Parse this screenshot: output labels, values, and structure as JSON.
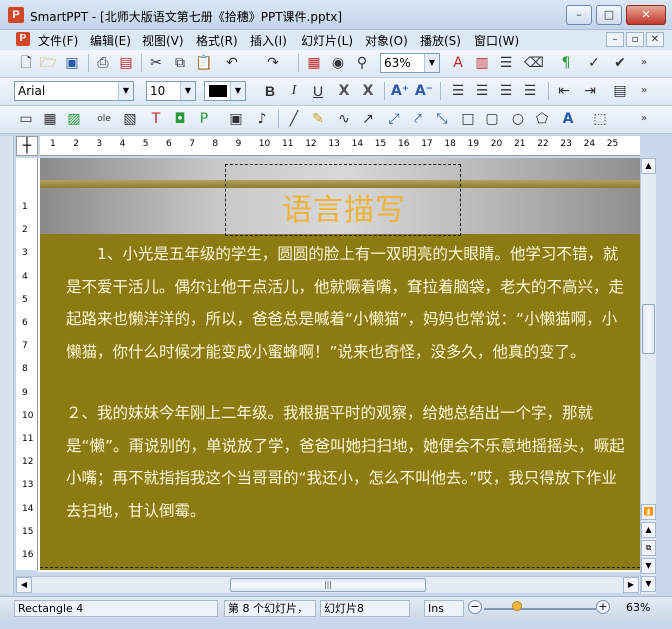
{
  "window": {
    "title": "SmartPPT - [北师大版语文第七册《拾穗》PPT课件.pptx]",
    "app_icon": "P",
    "buttons": [
      "–",
      "□",
      "✕"
    ]
  },
  "menu": {
    "items": [
      "文件(F)",
      "编辑(E)",
      "视图(V)",
      "格式(R)",
      "插入(I)",
      "幻灯片(L)",
      "对象(O)",
      "播放(S)",
      "窗口(W)"
    ],
    "mdi_buttons": [
      "–",
      "▫",
      "✕"
    ]
  },
  "toolbar1": {
    "zoom_value": "63%",
    "icons": [
      "new-doc-icon",
      "open-folder-icon",
      "save-icon",
      "print-icon",
      "pdf-icon",
      "cut-icon",
      "copy-icon",
      "paste-icon",
      "undo-icon",
      "redo-icon",
      "slide-icon",
      "preview-icon",
      "zoom-icon",
      "text-color-icon",
      "format-icon",
      "list-icon",
      "brush-icon",
      "paragraph-icon",
      "spell-icon"
    ]
  },
  "toolbar2": {
    "font": "Arial",
    "size": "10",
    "bold": "B",
    "italic": "I",
    "underline": "U",
    "strike": "X",
    "subscript": "X"
  },
  "toolbar3": {
    "icons": [
      "text-box-icon",
      "table-icon",
      "picture-icon",
      "ole-icon",
      "chart-icon",
      "text-frame-icon",
      "frame-icon",
      "frame-p-icon",
      "film-icon",
      "audio-icon",
      "line-icon",
      "pencil-icon",
      "curve-icon",
      "arrow-icon",
      "connector-icon",
      "elbow-icon",
      "rectangle-icon",
      "rounded-rect-icon",
      "ellipse-icon",
      "shapes-icon",
      "wordart-icon",
      "group-icon"
    ]
  },
  "ruler": {
    "h_numbers": [
      "1",
      "2",
      "3",
      "4",
      "5",
      "6",
      "7",
      "8",
      "9",
      "10",
      "11",
      "12",
      "13",
      "14",
      "15",
      "16",
      "17",
      "18",
      "19",
      "20",
      "21",
      "22",
      "23",
      "24",
      "25"
    ],
    "v_numbers": [
      "1",
      "2",
      "3",
      "4",
      "5",
      "6",
      "7",
      "8",
      "9",
      "10",
      "11",
      "12",
      "13",
      "14",
      "15",
      "16"
    ]
  },
  "slide": {
    "title": "语言描写",
    "paragraphs": [
      "　　1、小光是五年级的学生，圆圆的脸上有一双明亮的大眼睛。他学习不错，就是不爱干活儿。偶尔让他干点活儿，他就噘着嘴，耷拉着脑袋，老大的不高兴，走起路来也懒洋洋的，所以，爸爸总是喊着“小懒猫”，妈妈也常说：“小懒猫啊，小懒猫，你什么时候才能变成小蜜蜂啊！”说来也奇怪，没多久，他真的变了。",
      "２、我的妹妹今年刚上二年级。我根据平时的观察，给她总结出一个字，那就是“懒”。甭说别的，单说放了学，爸爸叫她扫扫地，她便会不乐意地摇摇头，噘起小嘴；再不就指指我这个当哥哥的“我还小，怎么不叫他去。”哎，我只得放下作业去扫地，甘认倒霉。"
    ]
  },
  "status": {
    "object": "Rectangle 4",
    "slide_pos": "第 8 个幻灯片，",
    "slide_name": "幻灯片8",
    "mode": "Ins",
    "zoom": "63%"
  },
  "colors": {
    "slide_bg": "#8c7a12",
    "title_color": "#f0b43a",
    "body_text": "#fff8d8"
  }
}
